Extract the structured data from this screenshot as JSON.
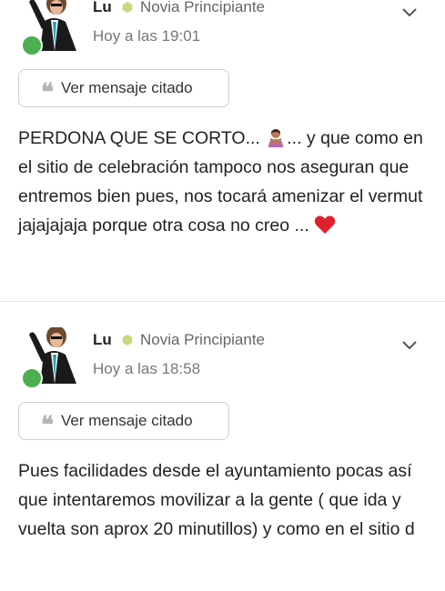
{
  "posts": [
    {
      "author": "Lu",
      "role": "Novia Principiante",
      "time": "Hoy a las 19:01",
      "quote_label": "Ver mensaje citado",
      "message_part1": "PERDONA QUE SE CORTO... ",
      "message_part2": "... y que como en el sitio de celebración tampoco nos aseguran que entremos bien pues, nos tocará amenizar el vermut jajajajaja porque otra cosa no creo ... ",
      "emoji_1": "person-gesturing-no",
      "emoji_2": "red-heart"
    },
    {
      "author": "Lu",
      "role": "Novia Principiante",
      "time": "Hoy a las 18:58",
      "quote_label": "Ver mensaje citado",
      "message": "Pues facilidades desde el ayuntamiento pocas así que intentaremos movilizar a la gente ( que ida y vuelta son aprox 20 minutillos) y como en el sitio d"
    }
  ],
  "colors": {
    "online": "#4caf50",
    "role_badge": "#c7d97a",
    "divider": "#e3e3e3",
    "heart": "#e0202a"
  },
  "icons": [
    "chevron-down-icon",
    "quote-icon",
    "online-status-icon",
    "role-badge-icon"
  ]
}
